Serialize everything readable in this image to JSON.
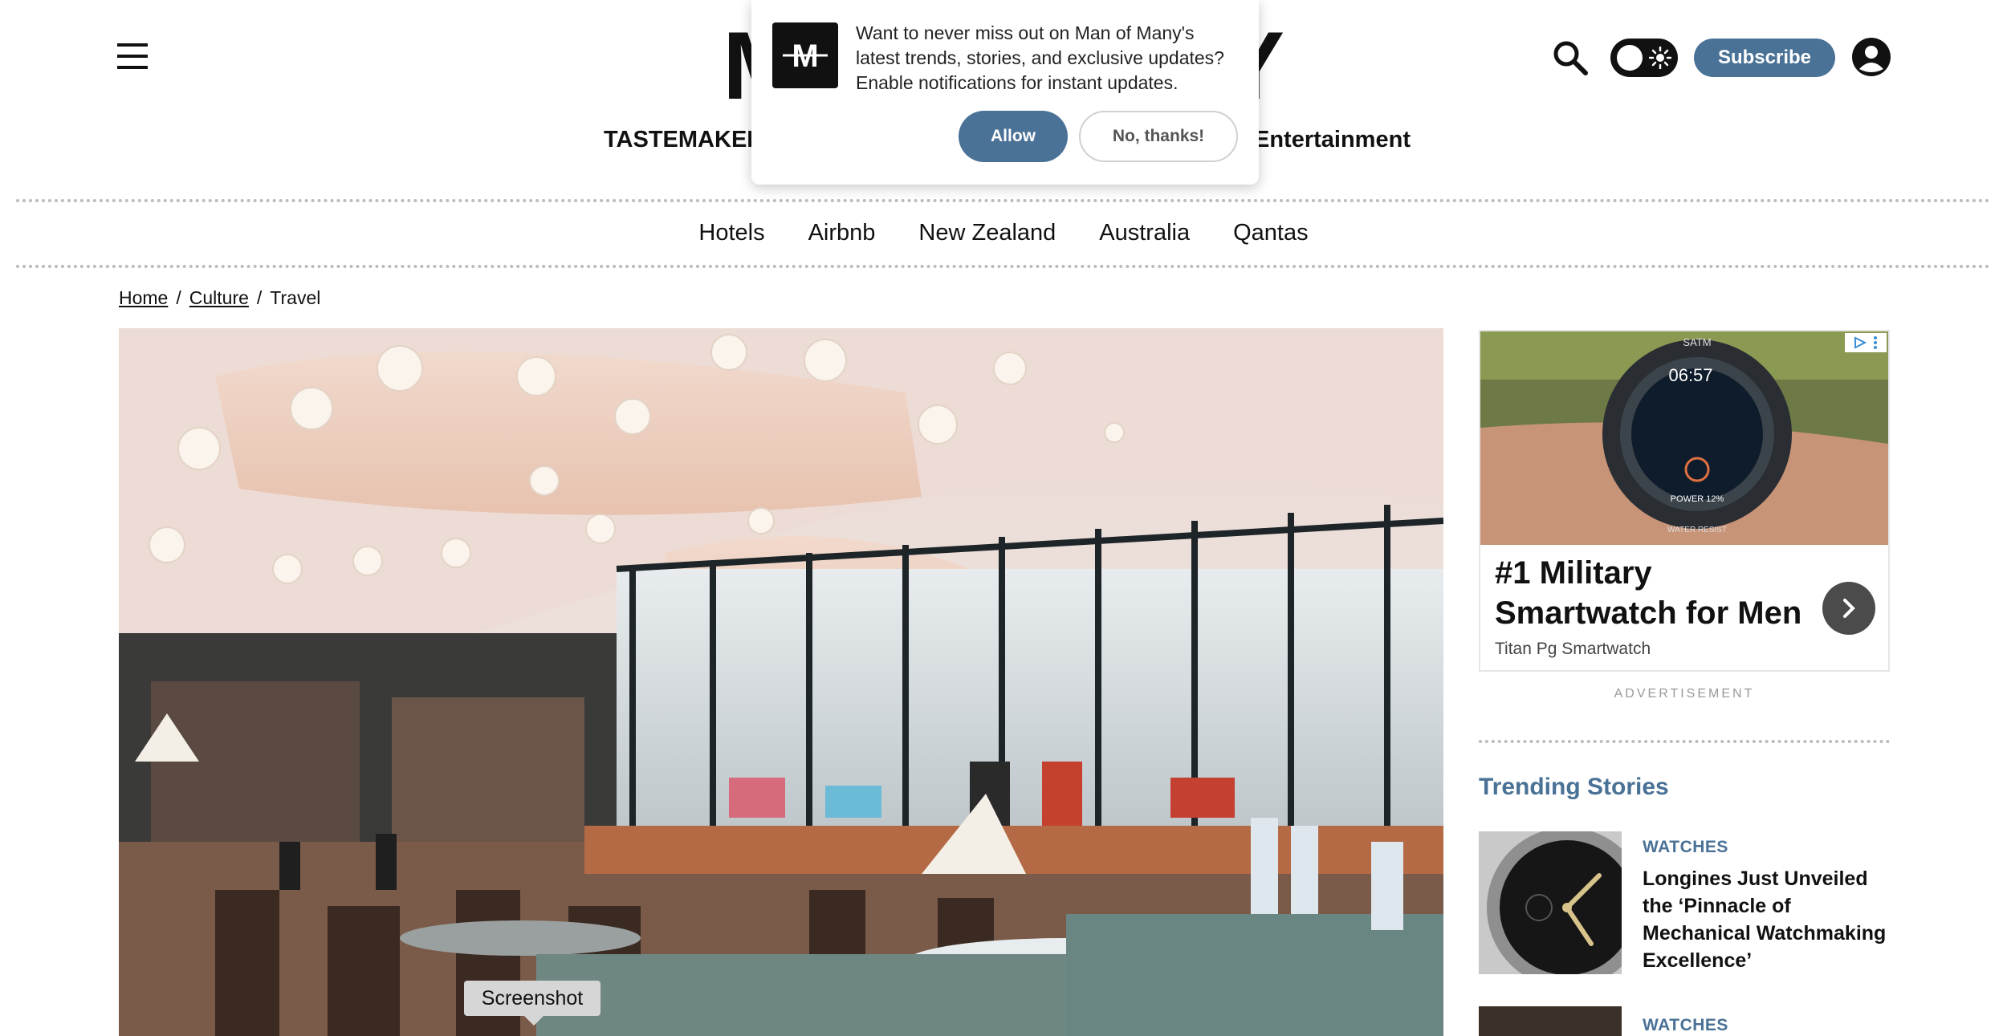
{
  "header": {
    "logo_left": "M",
    "logo_right": "Y",
    "subscribe_label": "Subscribe",
    "icons": [
      "menu-icon",
      "search-icon",
      "theme-toggle-icon",
      "account-icon"
    ]
  },
  "primary_nav": {
    "left_item": "TASTEMAKER",
    "right_item": "Entertainment"
  },
  "sub_nav": [
    "Hotels",
    "Airbnb",
    "New Zealand",
    "Australia",
    "Qantas"
  ],
  "breadcrumb": {
    "home": "Home",
    "culture": "Culture",
    "current": "Travel",
    "separator": "/"
  },
  "hero": {
    "tooltip": "Screenshot"
  },
  "ad": {
    "headline": "#1 Military Smartwatch for Men",
    "brand": "Titan Pg Smartwatch",
    "label": "ADVERTISEMENT",
    "watch_brand": "SATM",
    "watch_time": "06:57",
    "watch_power": "POWER 12%",
    "watch_bezel": "WATER RESIST"
  },
  "trending": {
    "title": "Trending Stories",
    "stories": [
      {
        "category": "WATCHES",
        "title": "Longines Just Unveiled the ‘Pinnacle of Mechanical Watchmaking Excellence’"
      },
      {
        "category": "WATCHES",
        "title": ""
      }
    ]
  },
  "popup": {
    "logo_letter": "M",
    "message": "Want to never miss out on Man of Many's latest trends, stories, and exclusive updates? Enable notifications for instant updates.",
    "allow_label": "Allow",
    "decline_label": "No, thanks!"
  },
  "colors": {
    "accent": "#4a7196",
    "text": "#111111"
  }
}
